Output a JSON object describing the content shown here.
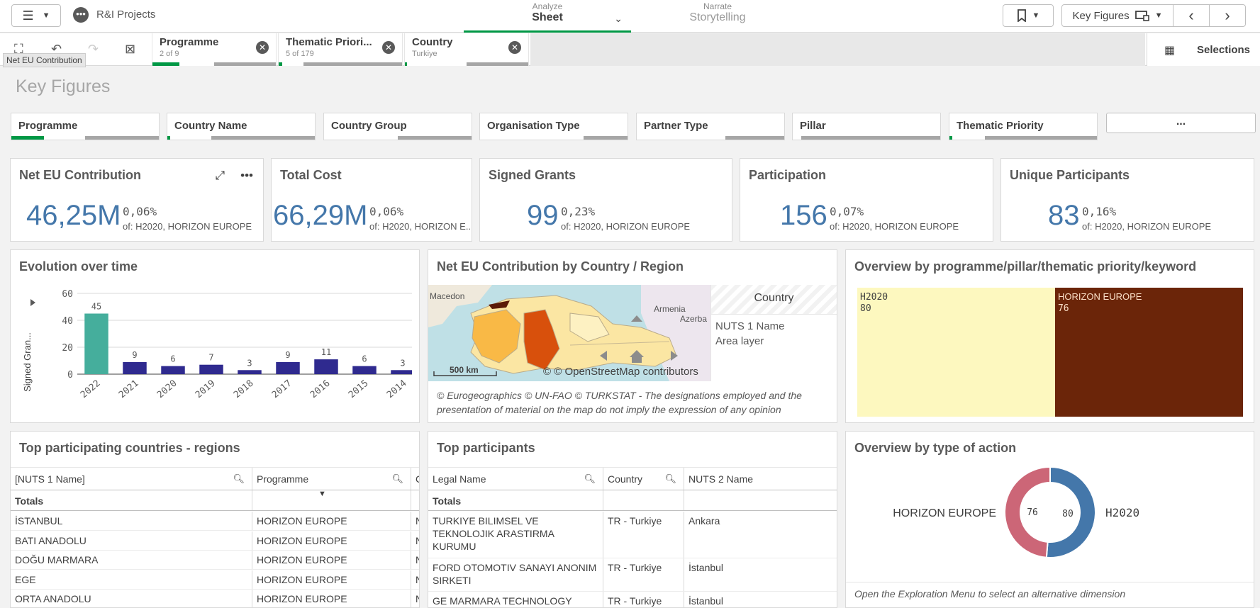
{
  "topbar": {
    "app_title": "R&I Projects",
    "analyze_small": "Analyze",
    "analyze_big": "Sheet",
    "narrate_small": "Narrate",
    "narrate_big": "Storytelling",
    "sheet_name": "Key Figures"
  },
  "selections": {
    "chips": [
      {
        "title": "Programme",
        "sub": "2 of 9"
      },
      {
        "title": "Thematic Priori...",
        "sub": "5 of 179"
      },
      {
        "title": "Country",
        "sub": "Turkiye"
      }
    ],
    "label": "Selections",
    "tooltip": "Net EU Contribution"
  },
  "sheet_title": "Key Figures",
  "filters": [
    "Programme",
    "Country Name",
    "Country Group",
    "Organisation Type",
    "Partner Type",
    "Pillar",
    "Thematic Priority"
  ],
  "filter_more": "...",
  "kpis": [
    {
      "title": "Net EU Contribution",
      "value": "46,25M",
      "pct": "0,06%",
      "of": "of: H2020, HORIZON EUROPE"
    },
    {
      "title": "Total Cost",
      "value": "66,29M",
      "pct": "0,06%",
      "of": "of: H2020, HORIZON E..."
    },
    {
      "title": "Signed Grants",
      "value": "99",
      "pct": "0,23%",
      "of": "of: H2020, HORIZON EUROPE"
    },
    {
      "title": "Participation",
      "value": "156",
      "pct": "0,07%",
      "of": "of: H2020, HORIZON EUROPE"
    },
    {
      "title": "Unique Participants",
      "value": "83",
      "pct": "0,16%",
      "of": "of: H2020, HORIZON EUROPE"
    }
  ],
  "evolution": {
    "title": "Evolution over time",
    "chart_data": {
      "type": "bar",
      "categories": [
        "2022",
        "2021",
        "2020",
        "2019",
        "2018",
        "2017",
        "2016",
        "2015",
        "2014"
      ],
      "values": [
        45,
        9,
        6,
        7,
        3,
        9,
        11,
        6,
        3
      ],
      "ylabel": "Signed Gran...",
      "ylim": [
        0,
        60
      ],
      "yticks": [
        0,
        20,
        40,
        60
      ],
      "colors": [
        "#45ae9c",
        "#2f2a8f"
      ],
      "grid": true
    }
  },
  "map": {
    "title": "Net EU Contribution by Country / Region",
    "legend_header": "Country",
    "legend_lines": [
      "NUTS 1 Name",
      "Area layer"
    ],
    "places": [
      "Macedon",
      "Armenia",
      "Azerba"
    ],
    "scale": "500 km",
    "attribution": "© © OpenStreetMap contributors",
    "footnote": "© Eurogeographics © UN-FAO © TURKSTAT -  The designations employed and the presentation of material on the map do not imply the expression of any opinion"
  },
  "treemap": {
    "title": "Overview by programme/pillar/thematic priority/keyword",
    "chart_data": {
      "type": "treemap",
      "items": [
        {
          "name": "H2020",
          "value": 80,
          "color": "#fdf8bf"
        },
        {
          "name": "HORIZON EUROPE",
          "value": 76,
          "color": "#6b2509"
        }
      ]
    }
  },
  "countries_table": {
    "title": "Top participating countries - regions",
    "headers": [
      "[NUTS 1 Name]",
      "Programme",
      "C"
    ],
    "totals": "Totals",
    "rows": [
      [
        "İSTANBUL",
        "HORIZON EUROPE",
        "N"
      ],
      [
        "BATI ANADOLU",
        "HORIZON EUROPE",
        "N"
      ],
      [
        "DOĞU MARMARA",
        "HORIZON EUROPE",
        "N"
      ],
      [
        "EGE",
        "HORIZON EUROPE",
        "N"
      ],
      [
        "ORTA ANADOLU",
        "HORIZON EUROPE",
        "N"
      ]
    ]
  },
  "participants_table": {
    "title": "Top participants",
    "headers": [
      "Legal Name",
      "Country",
      "NUTS 2 Name"
    ],
    "totals": "Totals",
    "rows": [
      [
        "TURKIYE BILIMSEL VE TEKNOLOJIK ARASTIRMA KURUMU",
        "TR - Turkiye",
        "Ankara"
      ],
      [
        "FORD OTOMOTIV SANAYI ANONIM SIRKETI",
        "TR - Turkiye",
        "İstanbul"
      ],
      [
        "GE MARMARA TECHNOLOGY",
        "TR - Turkiye",
        "İstanbul"
      ]
    ]
  },
  "action_type": {
    "title": "Overview by type of action",
    "chart_data": {
      "type": "pie",
      "slices": [
        {
          "name": "H2020",
          "value": 80,
          "color": "#4477aa"
        },
        {
          "name": "HORIZON EUROPE",
          "value": 76,
          "color": "#cc6677"
        }
      ]
    },
    "footnote": "Open the Exploration Menu to select an alternative dimension"
  }
}
